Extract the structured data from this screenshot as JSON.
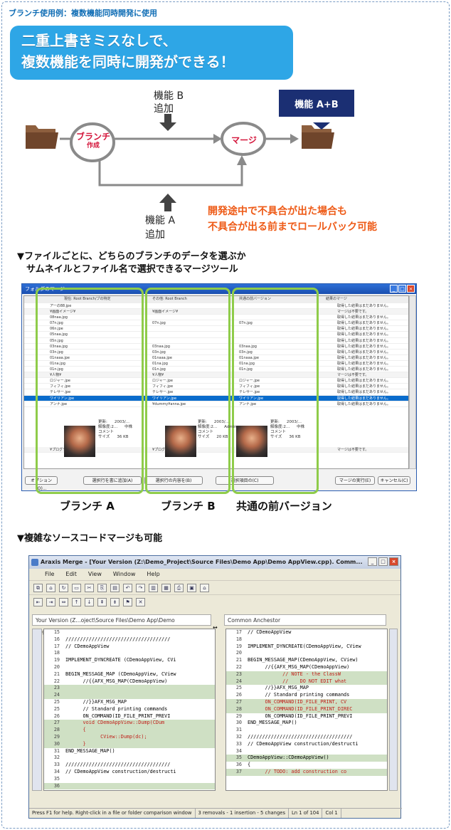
{
  "heading": "ブランチ使用例：複数機能同時開発に使用",
  "banner": {
    "line1": "二重上書きミスなしで、",
    "line2": "複数機能を同時に開発ができる！"
  },
  "flow": {
    "feature_b": [
      "機能 B",
      "追加"
    ],
    "feature_a": [
      "機能 A",
      "追加"
    ],
    "branch_node": [
      "ブランチ",
      "作成"
    ],
    "merge_node": "マージ",
    "result_box": "機能 A+B",
    "note": [
      "開発途中で不具合が出た場合も",
      "不具合が出る前までロールバック可能"
    ]
  },
  "section1": [
    "▼ファイルごとに、どちらのブランチのデータを選ぶか",
    "　サムネイルとファイル名で選択できるマージツール"
  ],
  "folder_window": {
    "title": "フォルダのマージ",
    "columns": [
      "現在: Root Branch/ブの特定",
      "その他: Root Branch",
      "共通の前バージョン",
      "結果のマージ"
    ],
    "rows": [
      {
        "c1": "アーの88.jpe",
        "c2": "",
        "c3": "",
        "c4": "取得した結果はまだありません。",
        "kind": "normal"
      },
      {
        "c1": "¥画面イメージ¥",
        "c2": "¥画面イメージ¥",
        "c3": "",
        "c4": "マージは不要です。",
        "kind": "grp"
      },
      {
        "c1": "08naa.jpg",
        "c2": "",
        "c3": "",
        "c4": "取得した結果はまだありません。",
        "kind": "normal"
      },
      {
        "c1": "07n.jpg",
        "c2": "07n.jpg",
        "c3": "07n.jpg",
        "c4": "取得した結果はまだありません。",
        "kind": "normal"
      },
      {
        "c1": "06n.jpe",
        "c2": "",
        "c3": "",
        "c4": "取得した結果はまだありません。",
        "kind": "normal"
      },
      {
        "c1": "05naa.jpg",
        "c2": "",
        "c3": "",
        "c4": "取得した結果はまだありません。",
        "kind": "normal"
      },
      {
        "c1": "05n.jpg",
        "c2": "",
        "c3": "",
        "c4": "取得した結果はまだありません。",
        "kind": "normal"
      },
      {
        "c1": "03naa.jpg",
        "c2": "03naa.jpg",
        "c3": "03naa.jpg",
        "c4": "取得した結果はまだありません。",
        "kind": "normal"
      },
      {
        "c1": "03n.jpg",
        "c2": "03n.jpg",
        "c3": "03n.jpg",
        "c4": "取得した結果はまだありません。",
        "kind": "normal"
      },
      {
        "c1": "01naaa.jpe",
        "c2": "01naaa.jpe",
        "c3": "01naaa.jpe",
        "c4": "取得した結果はまだありません。",
        "kind": "normal"
      },
      {
        "c1": "01na.jpg",
        "c2": "01na.jpg",
        "c3": "01na.jpg",
        "c4": "取得した結果はまだありません。",
        "kind": "normal"
      },
      {
        "c1": "01n.jpg",
        "c2": "01n.jpg",
        "c3": "01n.jpg",
        "c4": "取得した結果はまだありません。",
        "kind": "normal"
      },
      {
        "c1": "¥人物¥",
        "c2": "¥人物¥",
        "c3": "",
        "c4": "マージは不要です。",
        "kind": "grp"
      },
      {
        "c1": "ロジャー.jpe",
        "c2": "ロジャー.jpe",
        "c3": "ロジャー.jpe",
        "c4": "取得した結果はまだありません。",
        "kind": "normal"
      },
      {
        "c1": "フィフィ.jpe",
        "c2": "フィフィ.jpe",
        "c3": "フィフィ.jpe",
        "c4": "取得した結果はまだありません。",
        "kind": "normal"
      },
      {
        "c1": "テレサー.jpe",
        "c2": "テレサー.jpe",
        "c3": "テレサー.jpe",
        "c4": "取得した結果はまだありません。",
        "kind": "normal"
      },
      {
        "c1": "ワイリアン.jpe",
        "c2": "ワイリアン.jpe",
        "c3": "ワイリアン.jpe",
        "c4": "取得した結果はまだありません。",
        "kind": "sel"
      },
      {
        "c1": "アンナ.jpe",
        "c2": "¥dummy¥anna.jpe",
        "c3": "アンナ.jpe",
        "c4": "取得した結果はまだありません。",
        "kind": "normal"
      }
    ],
    "preview": [
      {
        "meta": [
          "更新:",
          "解像度:2...",
          "コメント",
          "サイズ"
        ],
        "vals": [
          "2003/...",
          "中株",
          "",
          "36 KB"
        ]
      },
      {
        "meta": [
          "更新:",
          "解像度:2...",
          "コメント",
          "サイズ"
        ],
        "vals": [
          "2003/...",
          "Admin...",
          "",
          "20 KB"
        ]
      },
      {
        "meta": [
          "更新:",
          "解像度:2...",
          "コメント",
          "サイズ"
        ],
        "vals": [
          "2003/...",
          "中株",
          "",
          "36 KB"
        ]
      }
    ],
    "bottom_row": {
      "c1": "¥プログラムコード¥",
      "c2": "¥プログラムコード¥",
      "c4": "マージは不要です。"
    },
    "buttons": {
      "options": "オプション(O)...",
      "sel1": "選択行を書に追加(A)",
      "sel2": "選択行の内容を(B)",
      "sel3": "選択項目の(C)",
      "run": "マージの実行(E)",
      "cancel": "キャンセル(C)"
    }
  },
  "branch_labels": [
    "ブランチ A",
    "ブランチ B",
    "共通の前バージョン"
  ],
  "section2": "▼複雑なソースコードマージも可能",
  "araxis": {
    "title": "Araxis Merge - [Your Version (Z:\\Demo_Project\\Source Files\\Demo App\\Demo AppView.cpp). Comm...",
    "menu": [
      "File",
      "Edit",
      "View",
      "Window",
      "Help"
    ],
    "left_header": "Your Version (Z...oject\\Source Files\\Demo App\\Demo AppView.cpp)",
    "right_header": "Common Anchestor",
    "left_lines": [
      {
        "n": "15",
        "t": "",
        "k": ""
      },
      {
        "n": "16",
        "t": "////////////////////////////////////",
        "k": ""
      },
      {
        "n": "17",
        "t": "// CDemoAppView",
        "k": ""
      },
      {
        "n": "18",
        "t": "",
        "k": ""
      },
      {
        "n": "19",
        "t": "IMPLEMENT_DYNCREATE (CDemoAppView, CVi",
        "k": ""
      },
      {
        "n": "20",
        "t": "",
        "k": ""
      },
      {
        "n": "21",
        "t": "BEGIN_MESSAGE_MAP (CDemoAppView, CView",
        "k": ""
      },
      {
        "n": "22",
        "t": "      //{{AFX_MSG_MAP(CDemoAppView)",
        "k": ""
      },
      {
        "n": "23",
        "t": "",
        "k": "chg"
      },
      {
        "n": "24",
        "t": "",
        "k": "chg"
      },
      {
        "n": "25",
        "t": "      //}}AFX_MSG_MAP",
        "k": ""
      },
      {
        "n": "25",
        "t": "      // Standard printing commands",
        "k": ""
      },
      {
        "n": "26",
        "t": "      ON_COMMAND(ID_FILE_PRINT_PREVI",
        "k": ""
      },
      {
        "n": "27",
        "t": "      void CDemoAppView::Dump(CDum",
        "k": "chg red"
      },
      {
        "n": "28",
        "t": "      {",
        "k": "chg red"
      },
      {
        "n": "29",
        "t": "            CView::Dump(dc);",
        "k": "chg red"
      },
      {
        "n": "30",
        "t": "      }",
        "k": "chg red"
      },
      {
        "n": "31",
        "t": "END_MESSAGE_MAP()",
        "k": ""
      },
      {
        "n": "32",
        "t": "",
        "k": ""
      },
      {
        "n": "33",
        "t": "////////////////////////////////////",
        "k": ""
      },
      {
        "n": "34",
        "t": "// CDemoAppView construction/destructi",
        "k": ""
      },
      {
        "n": "35",
        "t": "",
        "k": ""
      },
      {
        "n": "36",
        "t": "",
        "k": "chg"
      }
    ],
    "right_lines": [
      {
        "n": "17",
        "t": "// CDemoAppView",
        "k": ""
      },
      {
        "n": "18",
        "t": "",
        "k": ""
      },
      {
        "n": "19",
        "t": "IMPLEMENT_DYNCREATE(CDemoAppView, CView",
        "k": ""
      },
      {
        "n": "20",
        "t": "",
        "k": ""
      },
      {
        "n": "21",
        "t": "BEGIN_MESSAGE_MAP(CDemoAppView, CView)",
        "k": ""
      },
      {
        "n": "22",
        "t": "      //{{AFX_MSG_MAP(CDemoAppView)",
        "k": ""
      },
      {
        "n": "23",
        "t": "            // NOTE - the ClassW",
        "k": "chg red"
      },
      {
        "n": "24",
        "t": "            //    DO NOT EDIT what",
        "k": "chg red"
      },
      {
        "n": "25",
        "t": "      //}}AFX_MSG_MAP",
        "k": ""
      },
      {
        "n": "26",
        "t": "      // Standard printing commands",
        "k": ""
      },
      {
        "n": "27",
        "t": "      ON_COMMAND(ID_FILE_PRINT, CV",
        "k": "chg red"
      },
      {
        "n": "28",
        "t": "      ON_COMMAND(ID_FILE_PRINT_DIREC",
        "k": "chg red"
      },
      {
        "n": "29",
        "t": "      ON_COMMAND(ID_FILE_PRINT_PREVI",
        "k": ""
      },
      {
        "n": "30",
        "t": "END_MESSAGE_MAP()",
        "k": ""
      },
      {
        "n": "31",
        "t": "",
        "k": ""
      },
      {
        "n": "32",
        "t": "////////////////////////////////////",
        "k": ""
      },
      {
        "n": "33",
        "t": "// CDemoAppView construction/destructi",
        "k": ""
      },
      {
        "n": "34",
        "t": "",
        "k": ""
      },
      {
        "n": "35",
        "t": "CDemoAppView::CDemoAppView()",
        "k": "chg"
      },
      {
        "n": "36",
        "t": "{",
        "k": ""
      },
      {
        "n": "37",
        "t": "      // TODO: add construction co",
        "k": "chg red"
      }
    ],
    "status": [
      "Press F1 for help. Right-click in a file or folder comparison window",
      "3 removals - 1 insertion - 5 changes",
      "Ln 1 of 104",
      "Col 1"
    ]
  },
  "colors": {
    "accent": "#2ea6e6",
    "merge": "#d4143a",
    "note": "#ee5a16",
    "box": "#1b2f73",
    "green": "#8fcc4a"
  }
}
